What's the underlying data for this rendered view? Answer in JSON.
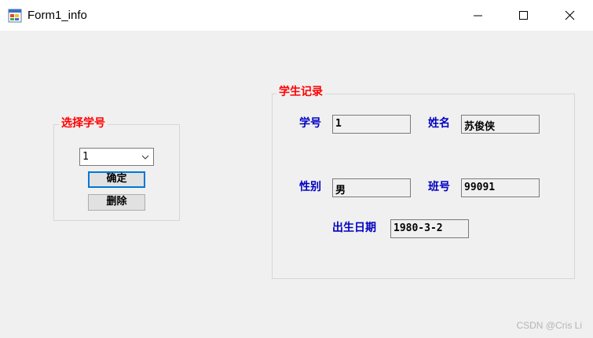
{
  "window": {
    "title": "Form1_info",
    "icon": "winforms-app-icon",
    "controls": [
      "minimize-icon",
      "maximize-icon",
      "close-icon"
    ]
  },
  "select_group": {
    "legend": "选择学号",
    "combo_value": "1",
    "confirm_label": "确定",
    "delete_label": "删除"
  },
  "record_group": {
    "legend": "学生记录",
    "fields": {
      "student_id": {
        "label": "学号",
        "value": "1"
      },
      "name": {
        "label": "姓名",
        "value": "苏俊侠"
      },
      "gender": {
        "label": "性别",
        "value": "男"
      },
      "class_no": {
        "label": "班号",
        "value": "99091"
      },
      "birth_date": {
        "label": "出生日期",
        "value": "1980-3-2"
      }
    }
  },
  "watermark": "CSDN @Cris Li",
  "colors": {
    "legend": "#ff0000",
    "label": "#0000c0",
    "focus_border": "#0078d7",
    "background": "#f0f0f0"
  }
}
